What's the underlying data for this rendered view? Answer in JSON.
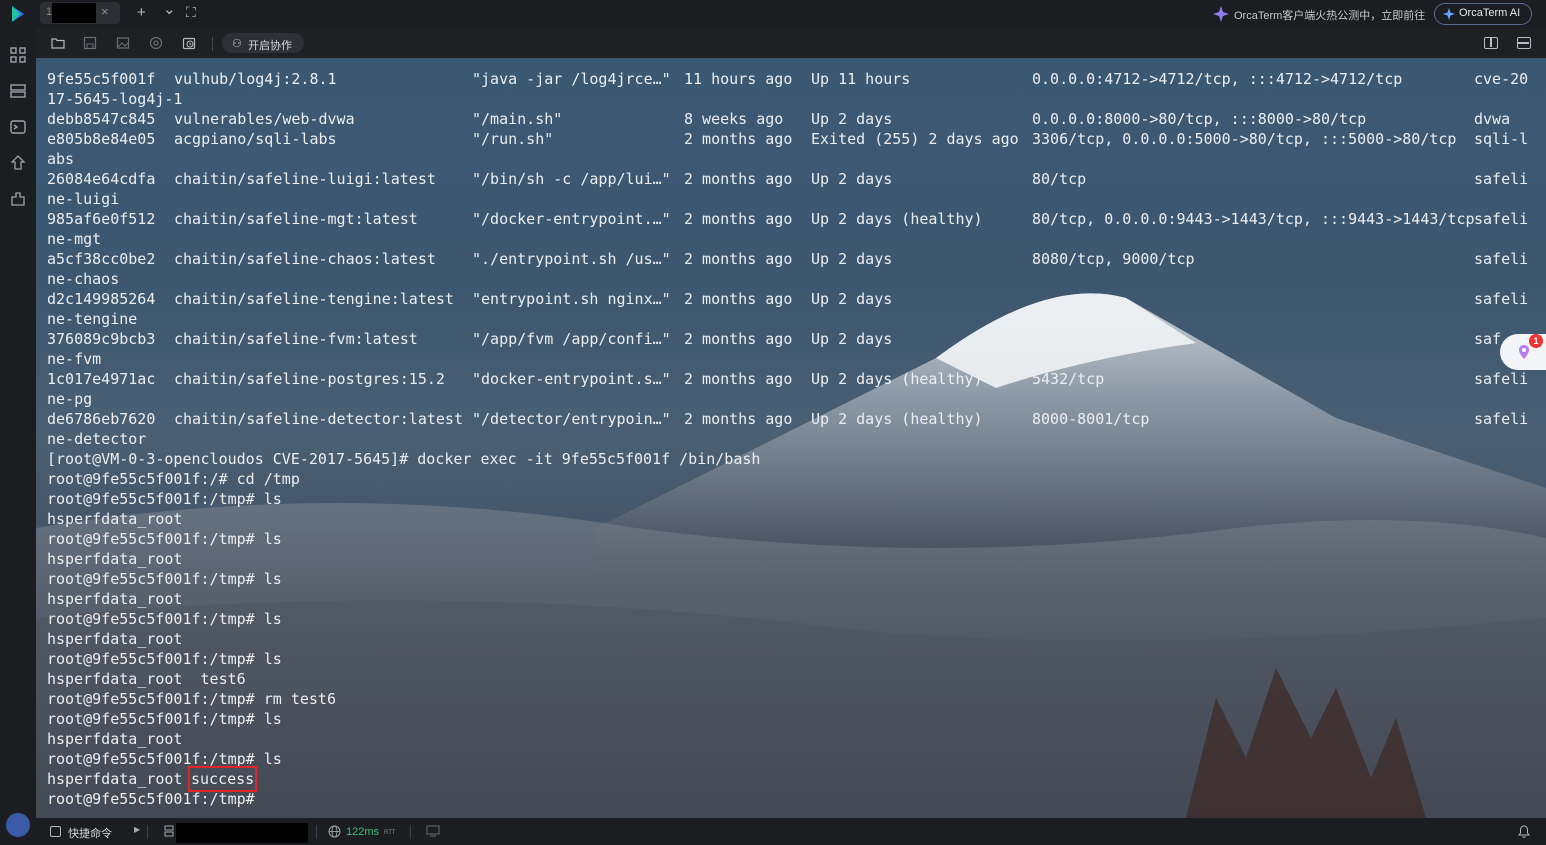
{
  "tab": {
    "number": "1",
    "close": "×"
  },
  "topbar": {
    "new_tab": "+",
    "dropdown": "⌄",
    "fullscreen": "⛶",
    "promo_text": "OrcaTerm客户端火热公测中，立即前往",
    "ai_button": "OrcaTerm AI"
  },
  "toolbar": {
    "collab_label": "开启协作"
  },
  "terminal": {
    "rows": [
      {
        "id": "9fe55c5f001f",
        "image": "vulhub/log4j:2.8.1",
        "command": "\"java -jar /log4jrce…\"",
        "created": "11 hours ago",
        "status": "Up 11 hours",
        "ports": "0.0.0.0:4712->4712/tcp, :::4712->4712/tcp",
        "name": "cve-20",
        "wrap": "17-5645-log4j-1"
      },
      {
        "id": "debb8547c845",
        "image": "vulnerables/web-dvwa",
        "command": "\"/main.sh\"",
        "created": "8 weeks ago",
        "status": "Up 2 days",
        "ports": "0.0.0.0:8000->80/tcp, :::8000->80/tcp",
        "name": "dvwa",
        "wrap": ""
      },
      {
        "id": "e805b8e84e05",
        "image": "acgpiano/sqli-labs",
        "command": "\"/run.sh\"",
        "created": "2 months ago",
        "status": "Exited (255) 2 days ago",
        "ports": "3306/tcp, 0.0.0.0:5000->80/tcp, :::5000->80/tcp",
        "name": "sqli-l",
        "wrap": "abs"
      },
      {
        "id": "26084e64cdfa",
        "image": "chaitin/safeline-luigi:latest",
        "command": "\"/bin/sh -c /app/lui…\"",
        "created": "2 months ago",
        "status": "Up 2 days",
        "ports": "80/tcp",
        "name": "safeli",
        "wrap": "ne-luigi"
      },
      {
        "id": "985af6e0f512",
        "image": "chaitin/safeline-mgt:latest",
        "command": "\"/docker-entrypoint.…\"",
        "created": "2 months ago",
        "status": "Up 2 days (healthy)",
        "ports": "80/tcp, 0.0.0.0:9443->1443/tcp, :::9443->1443/tcp",
        "name": "safeli",
        "wrap": "ne-mgt"
      },
      {
        "id": "a5cf38cc0be2",
        "image": "chaitin/safeline-chaos:latest",
        "command": "\"./entrypoint.sh /us…\"",
        "created": "2 months ago",
        "status": "Up 2 days",
        "ports": "8080/tcp, 9000/tcp",
        "name": "safeli",
        "wrap": "ne-chaos"
      },
      {
        "id": "d2c149985264",
        "image": "chaitin/safeline-tengine:latest",
        "command": "\"entrypoint.sh nginx…\"",
        "created": "2 months ago",
        "status": "Up 2 days",
        "ports": "",
        "name": "safeli",
        "wrap": "ne-tengine"
      },
      {
        "id": "376089c9bcb3",
        "image": "chaitin/safeline-fvm:latest",
        "command": "\"/app/fvm /app/confi…\"",
        "created": "2 months ago",
        "status": "Up 2 days",
        "ports": "",
        "name": "saf",
        "wrap": "ne-fvm"
      },
      {
        "id": "1c017e4971ac",
        "image": "chaitin/safeline-postgres:15.2",
        "command": "\"docker-entrypoint.s…\"",
        "created": "2 months ago",
        "status": "Up 2 days (healthy)",
        "ports": "5432/tcp",
        "name": "safeli",
        "wrap": "ne-pg"
      },
      {
        "id": "de6786eb7620",
        "image": "chaitin/safeline-detector:latest",
        "command": "\"/detector/entrypoin…\"",
        "created": "2 months ago",
        "status": "Up 2 days (healthy)",
        "ports": "8000-8001/tcp",
        "name": "safeli",
        "wrap": "ne-detector"
      }
    ],
    "session": [
      "[root@VM-0-3-opencloudos CVE-2017-5645]# docker exec -it 9fe55c5f001f /bin/bash",
      "root@9fe55c5f001f:/# cd /tmp",
      "root@9fe55c5f001f:/tmp# ls",
      "hsperfdata_root",
      "root@9fe55c5f001f:/tmp# ls",
      "hsperfdata_root",
      "root@9fe55c5f001f:/tmp# ls",
      "hsperfdata_root",
      "root@9fe55c5f001f:/tmp# ls",
      "hsperfdata_root",
      "root@9fe55c5f001f:/tmp# ls",
      "hsperfdata_root  test6",
      "root@9fe55c5f001f:/tmp# rm test6",
      "root@9fe55c5f001f:/tmp# ls",
      "hsperfdata_root",
      "root@9fe55c5f001f:/tmp# ls"
    ],
    "last_output_prefix": "hsperfdata_root",
    "last_output_highlight": "success",
    "final_prompt": "root@9fe55c5f001f:/tmp#",
    "float_badge": "1"
  },
  "statusbar": {
    "quick_label": "快捷命令",
    "latency": "122ms",
    "rtt": "RTT"
  },
  "colors": {
    "accent_red": "#e0262a",
    "latency_green": "#3fbf7f",
    "badge_red": "#ee3333"
  }
}
